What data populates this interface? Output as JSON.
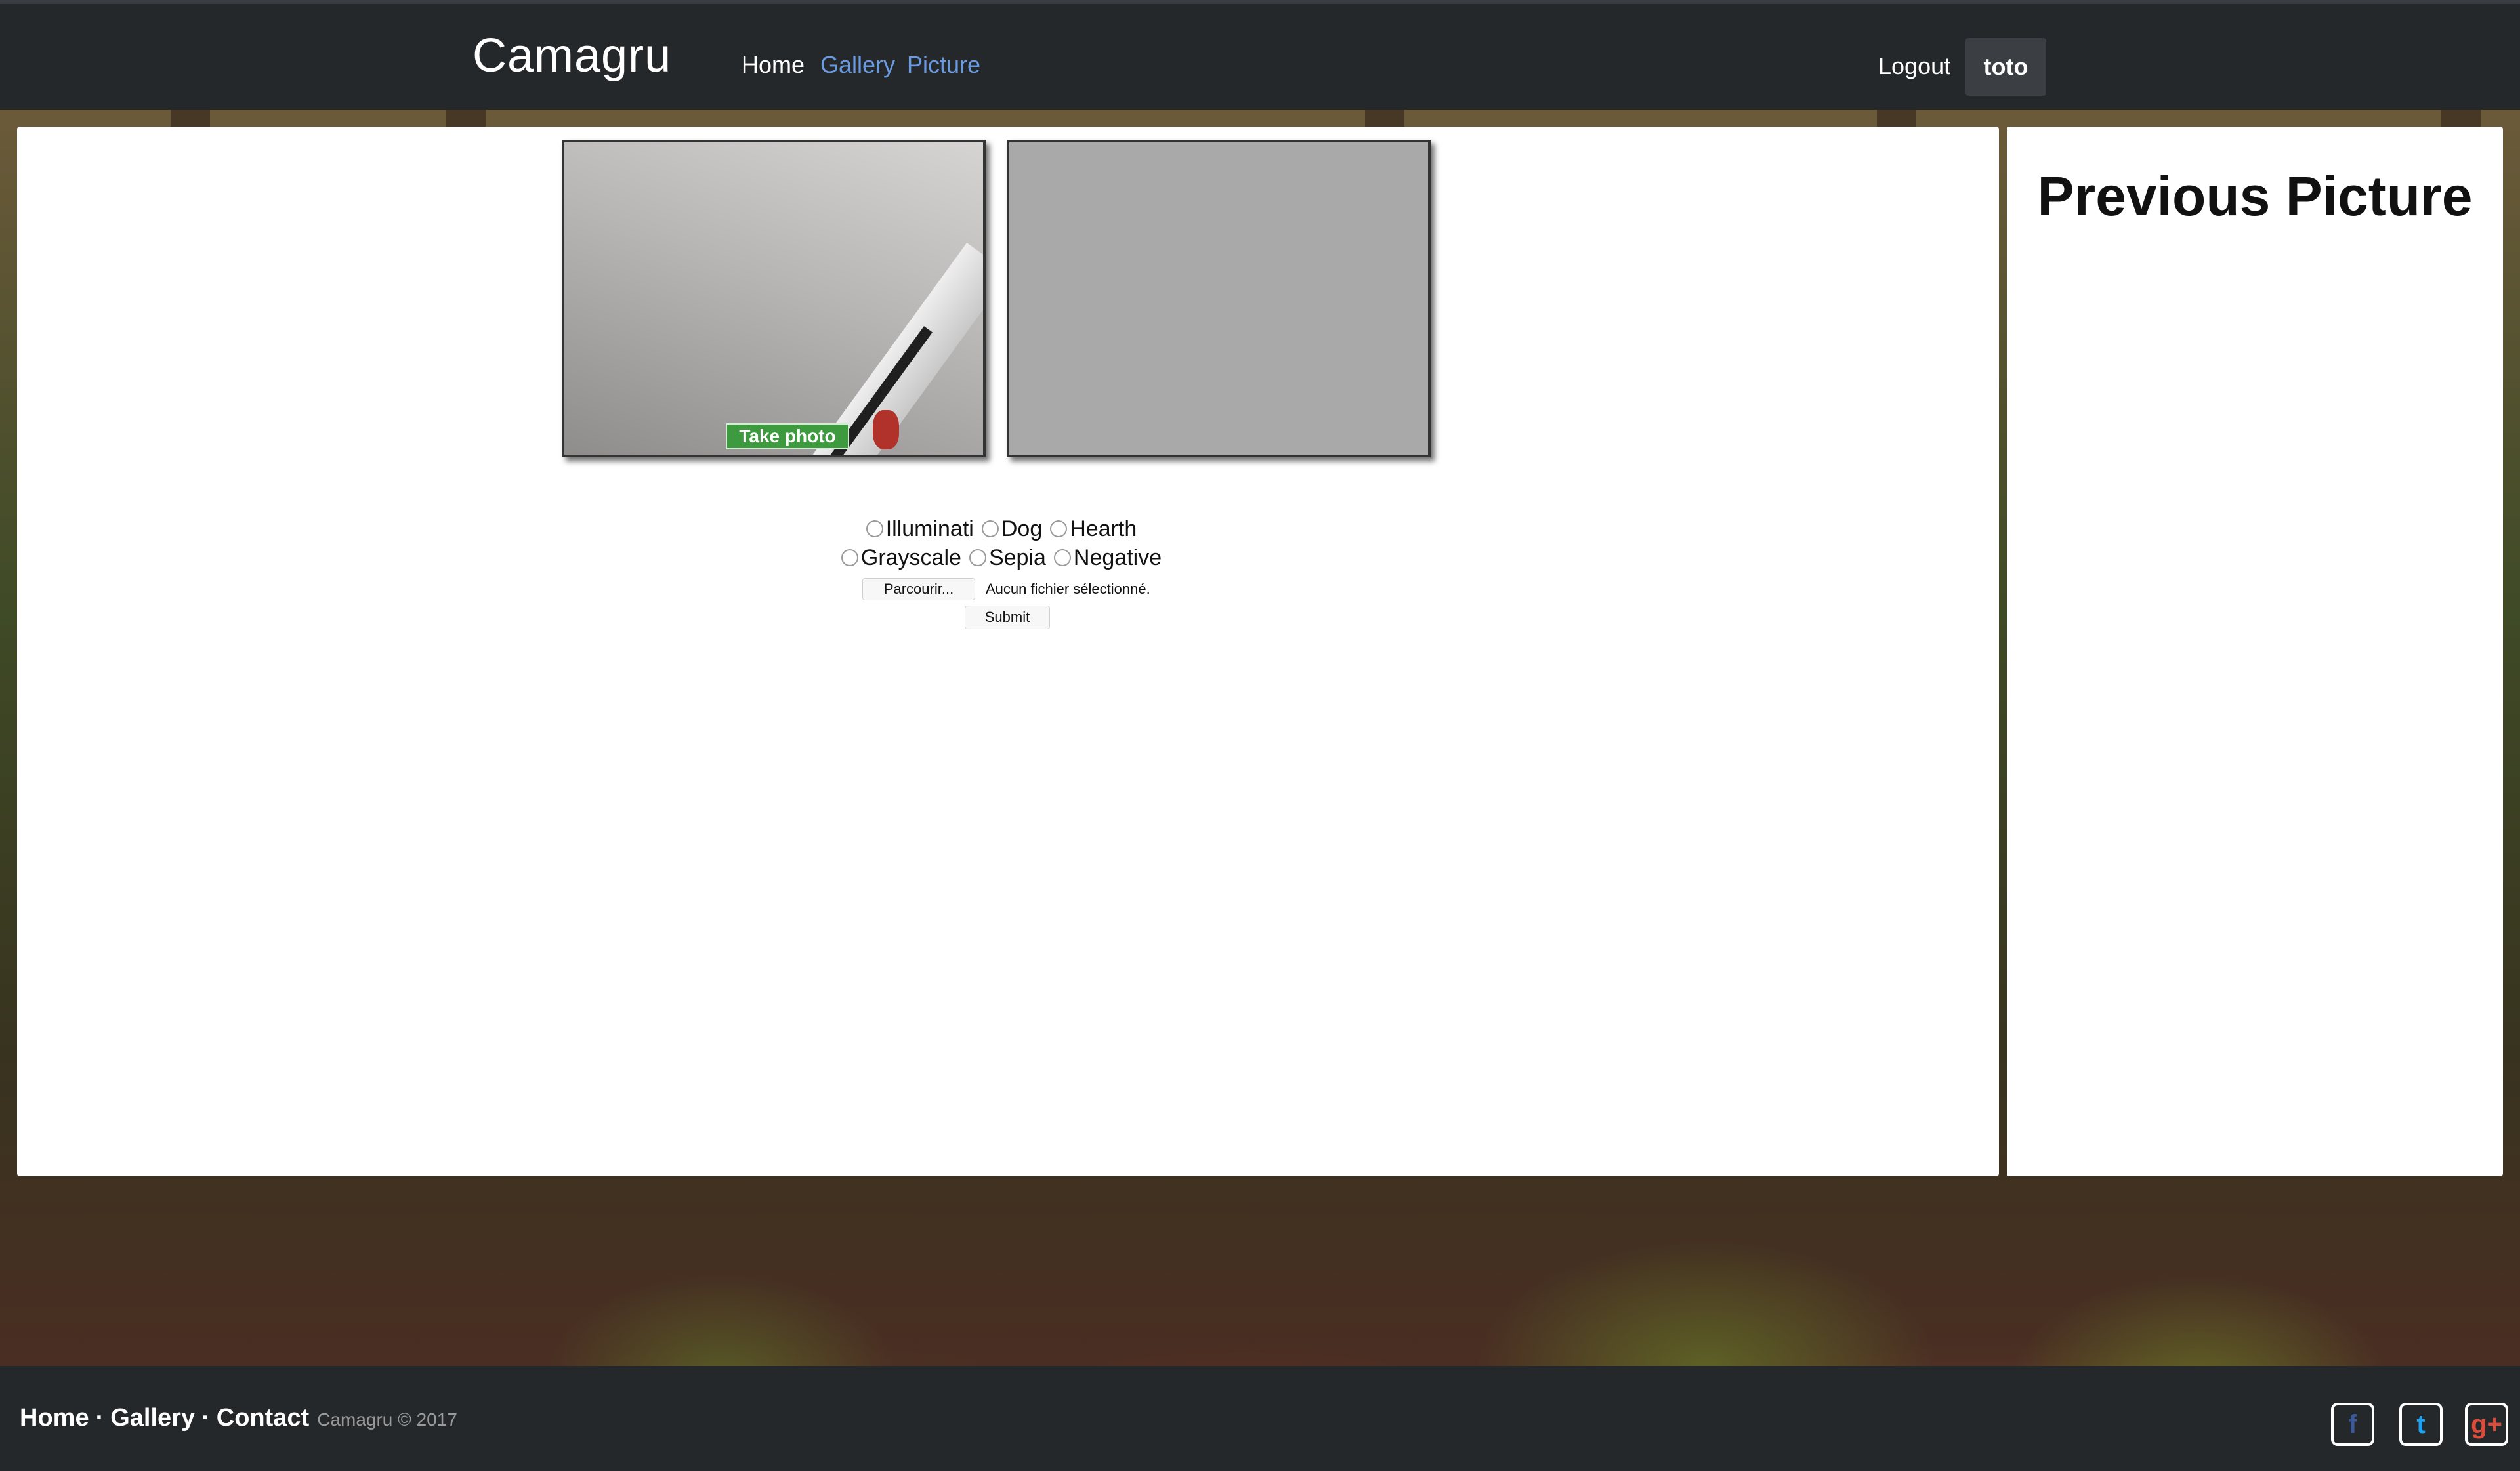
{
  "navbar": {
    "brand": "Camagru",
    "links": [
      "Home",
      "Gallery",
      "Picture"
    ],
    "logout": "Logout",
    "user": "toto"
  },
  "main": {
    "take_photo": "Take photo",
    "filters": {
      "row1": [
        "Illuminati",
        "Dog",
        "Hearth"
      ],
      "row2": [
        "Grayscale",
        "Sepia",
        "Negative"
      ]
    },
    "file": {
      "browse": "Parcourir...",
      "status": "Aucun fichier sélectionné."
    },
    "submit": "Submit"
  },
  "side": {
    "title": "Previous Picture"
  },
  "footer": {
    "links": [
      "Home",
      "Gallery",
      "Contact"
    ],
    "copyright": "Camagru © 2017",
    "social": [
      {
        "icon": "facebook-icon",
        "glyph": "f",
        "color": "#3b5998"
      },
      {
        "icon": "twitter-icon",
        "glyph": "t",
        "color": "#1da1f2"
      },
      {
        "icon": "google-plus-icon",
        "glyph": "g+",
        "color": "#dd4b39"
      }
    ]
  },
  "colors": {
    "navbar_bg": "#25282b",
    "link_blue": "#6a9be0",
    "take_photo_green": "#3e9a3e"
  }
}
